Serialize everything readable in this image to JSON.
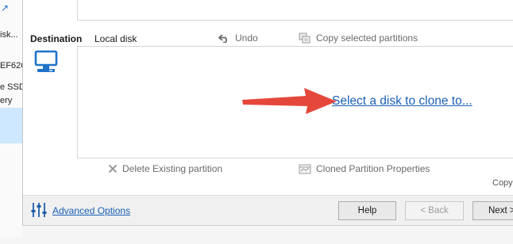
{
  "background_window": {
    "items": [
      "isk...",
      "EF626",
      "e SSD (",
      "ery"
    ]
  },
  "destination": {
    "label": "Destination",
    "disk_name": "Local disk",
    "undo_label": "Undo",
    "copy_selected_label": "Copy selected partitions",
    "clone_link": "Select a disk to clone to...",
    "delete_label": "Delete Existing partition",
    "cloned_props_label": "Cloned Partition Properties",
    "copy_fragment": "Copy"
  },
  "footer": {
    "advanced_options": "Advanced Options",
    "help": "Help",
    "back": "< Back",
    "next": "Next >"
  },
  "colors": {
    "link": "#1a5fb4",
    "arrow": "#e5483b",
    "selected_row": "#cde8ff"
  },
  "icons": [
    "monitor-icon",
    "undo-icon",
    "copy-partitions-icon",
    "delete-x-icon",
    "partition-properties-icon",
    "advanced-options-sliders-icon",
    "red-arrow"
  ]
}
